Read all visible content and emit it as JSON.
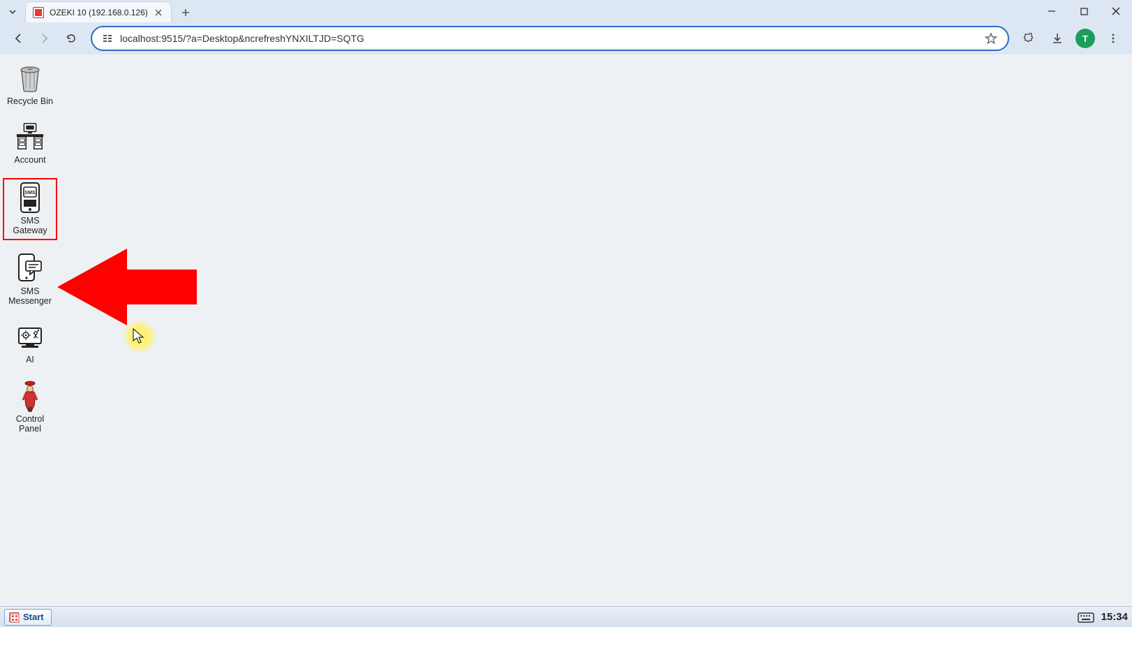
{
  "browser": {
    "tab_title": "OZEKI 10 (192.168.0.126)",
    "url": "localhost:9515/?a=Desktop&ncrefreshYNXILTJD=SQTG",
    "profile_initial": "T"
  },
  "desktop_icons": [
    {
      "id": "recycle-bin",
      "label": "Recycle Bin",
      "highlighted": false
    },
    {
      "id": "account",
      "label": "Account",
      "highlighted": false
    },
    {
      "id": "sms-gateway",
      "label": "SMS\nGateway",
      "highlighted": true
    },
    {
      "id": "sms-messenger",
      "label": "SMS\nMessenger",
      "highlighted": false
    },
    {
      "id": "ai",
      "label": "AI",
      "highlighted": false
    },
    {
      "id": "control-panel",
      "label": "Control\nPanel",
      "highlighted": false
    }
  ],
  "taskbar": {
    "start_label": "Start",
    "clock": "15:34"
  }
}
